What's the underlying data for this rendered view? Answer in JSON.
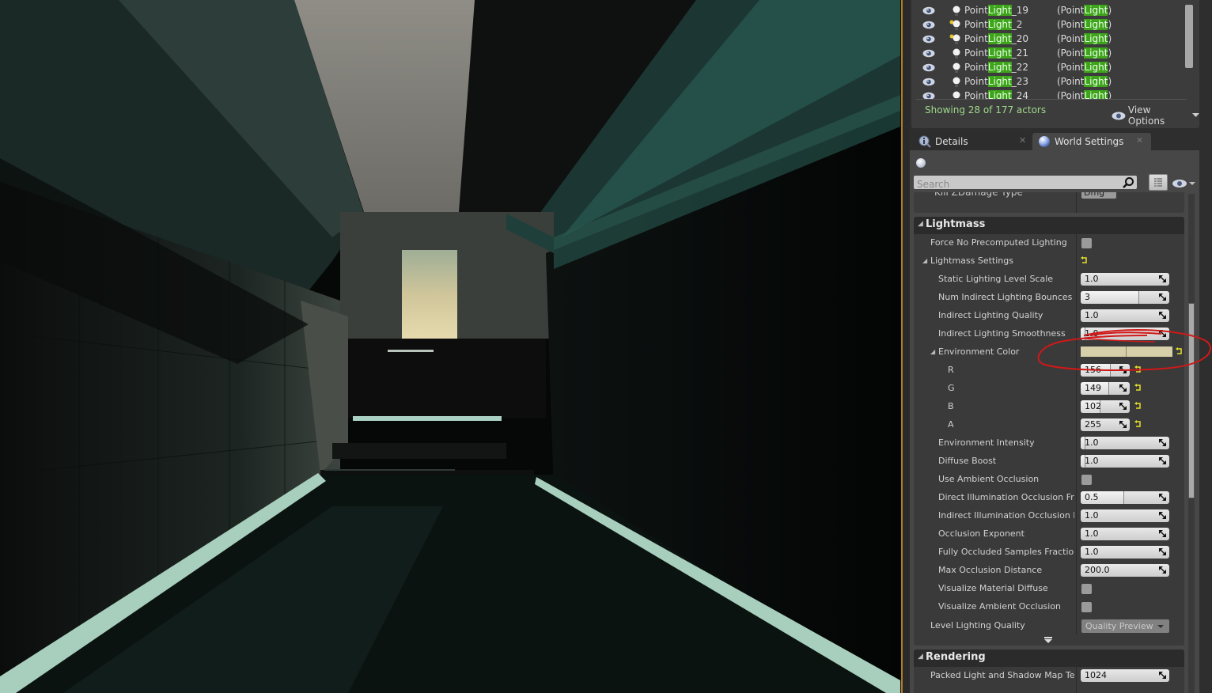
{
  "colors": {
    "highlight": "#3ea51b",
    "status_text": "#9fd88a",
    "environment_color": "#d7cfa9",
    "annotation": "#d01818",
    "viewport_border": "#b07d22"
  },
  "outliner": {
    "rows": [
      {
        "name_pre": "Point",
        "name_hl": "Light",
        "name_post": "_19",
        "type_pre": "(Point",
        "type_hl": "Light",
        "type_post": ")",
        "icon": "point-light-icon",
        "selected_dot": false
      },
      {
        "name_pre": "Point",
        "name_hl": "Light",
        "name_post": "_2",
        "type_pre": "(Point",
        "type_hl": "Light",
        "type_post": ")",
        "icon": "point-light-icon",
        "selected_dot": true
      },
      {
        "name_pre": "Point",
        "name_hl": "Light",
        "name_post": "_20",
        "type_pre": "(Point",
        "type_hl": "Light",
        "type_post": ")",
        "icon": "point-light-icon",
        "selected_dot": true
      },
      {
        "name_pre": "Point",
        "name_hl": "Light",
        "name_post": "_21",
        "type_pre": "(Point",
        "type_hl": "Light",
        "type_post": ")",
        "icon": "point-light-icon",
        "selected_dot": false
      },
      {
        "name_pre": "Point",
        "name_hl": "Light",
        "name_post": "_22",
        "type_pre": "(Point",
        "type_hl": "Light",
        "type_post": ")",
        "icon": "point-light-icon",
        "selected_dot": false
      },
      {
        "name_pre": "Point",
        "name_hl": "Light",
        "name_post": "_23",
        "type_pre": "(Point",
        "type_hl": "Light",
        "type_post": ")",
        "icon": "point-light-icon",
        "selected_dot": false
      },
      {
        "name_pre": "Point",
        "name_hl": "Light",
        "name_post": "_24",
        "type_pre": "(Point",
        "type_hl": "Light",
        "type_post": ")",
        "icon": "point-light-icon",
        "selected_dot": false
      }
    ],
    "status": "Showing 28 of 177 actors",
    "view_options_label": "View Options"
  },
  "tabs": [
    {
      "label": "Details",
      "icon": "info-icon",
      "active": false
    },
    {
      "label": "World Settings",
      "icon": "globe-icon",
      "active": true
    }
  ],
  "details": {
    "search_placeholder": "Search",
    "previous_row": {
      "label": "Kill ZDamage Type",
      "value": "Dmg"
    },
    "lightmass": {
      "title": "Lightmass",
      "force_no_precomputed_lighting": {
        "label": "Force No Precomputed Lighting",
        "checked": false
      },
      "lightmass_settings": {
        "label": "Lightmass Settings",
        "static_lighting_level_scale": {
          "label": "Static Lighting Level Scale",
          "value": "1.0",
          "slider_fraction": 0.0
        },
        "num_indirect_lighting_bounces": {
          "label": "Num Indirect Lighting Bounces",
          "value": "3",
          "slider_fraction": 0.66
        },
        "indirect_lighting_quality": {
          "label": "Indirect Lighting Quality",
          "value": "1.0",
          "slider_fraction": 0.0
        },
        "indirect_lighting_smoothness": {
          "label": "Indirect Lighting Smoothness",
          "value": "1.0",
          "slider_fraction": 0.05
        },
        "environment_color": {
          "label": "Environment Color",
          "hex": "#d7cfa9",
          "r": {
            "label": "R",
            "value": "156",
            "slider_fraction": 0.61
          },
          "g": {
            "label": "G",
            "value": "149",
            "slider_fraction": 0.58
          },
          "b": {
            "label": "B",
            "value": "102",
            "slider_fraction": 0.4
          },
          "a": {
            "label": "A",
            "value": "255",
            "slider_fraction": 0.0
          }
        },
        "environment_intensity": {
          "label": "Environment Intensity",
          "value": "1.0",
          "slider_fraction": 0.05
        },
        "diffuse_boost": {
          "label": "Diffuse Boost",
          "value": "1.0",
          "slider_fraction": 0.05
        },
        "use_ambient_occlusion": {
          "label": "Use Ambient Occlusion",
          "checked": false
        },
        "direct_illumination_occlusion_fraction": {
          "label": "Direct Illumination Occlusion Frac",
          "value": "0.5",
          "slider_fraction": 0.49
        },
        "indirect_illumination_occlusion_fraction": {
          "label": "Indirect Illumination Occlusion Fra",
          "value": "1.0",
          "slider_fraction": 0.0
        },
        "occlusion_exponent": {
          "label": "Occlusion Exponent",
          "value": "1.0",
          "slider_fraction": 0.0
        },
        "fully_occluded_samples_fraction": {
          "label": "Fully Occluded Samples Fraction",
          "value": "1.0",
          "slider_fraction": 0.0
        },
        "max_occlusion_distance": {
          "label": "Max Occlusion Distance",
          "value": "200.0",
          "slider_fraction": 0.0
        },
        "visualize_material_diffuse": {
          "label": "Visualize Material Diffuse",
          "checked": false
        },
        "visualize_ambient_occlusion": {
          "label": "Visualize Ambient Occlusion",
          "checked": false
        }
      },
      "level_lighting_quality": {
        "label": "Level Lighting Quality",
        "value": "Quality Preview"
      }
    },
    "rendering": {
      "title": "Rendering",
      "packed_light_and_shadow_map_texture_size": {
        "label": "Packed Light and Shadow Map Text",
        "value": "1024"
      }
    },
    "scroll_position_fraction": 0.36
  }
}
